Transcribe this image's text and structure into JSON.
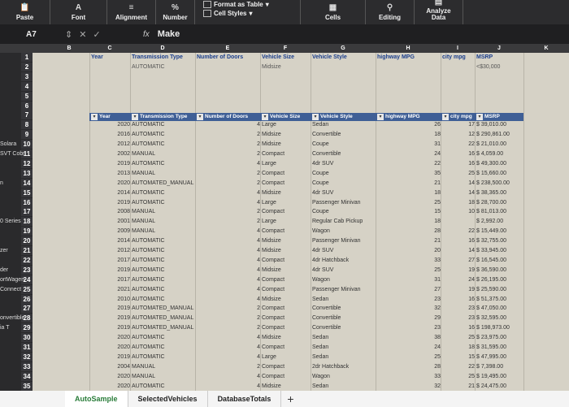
{
  "ribbon": {
    "paste": "Paste",
    "font": "Font",
    "alignment": "Alignment",
    "number": "Number",
    "format_as_table": "Format as Table",
    "cell_styles": "Cell Styles",
    "cells": "Cells",
    "editing": "Editing",
    "analyze_data": "Analyze Data"
  },
  "formula_bar": {
    "name_box": "A7",
    "fx": "fx",
    "value": "Make"
  },
  "columns": [
    "B",
    "C",
    "D",
    "E",
    "F",
    "G",
    "H",
    "I",
    "J",
    "K"
  ],
  "criteria": {
    "headers": [
      "Year",
      "Transmission Type",
      "Number of Doors",
      "Vehicle Size",
      "Vehicle Style",
      "highway MPG",
      "city mpg",
      "MSRP"
    ],
    "values": [
      "",
      "AUTOMATIC",
      "",
      "Midsize",
      "",
      "",
      "",
      "<$30,000"
    ]
  },
  "table_headers": [
    "Year",
    "Transmission Type",
    "Number of Doors",
    "Vehicle Size",
    "Vehicle Style",
    "highway MPG",
    "city mpg",
    "MSRP"
  ],
  "row_numbers": [
    "1",
    "2",
    "3",
    "4",
    "5",
    "6",
    "7",
    "8",
    "9",
    "10",
    "11",
    "12",
    "13",
    "14",
    "15",
    "16",
    "17",
    "18",
    "19",
    "20",
    "21",
    "22",
    "23",
    "24",
    "25",
    "26",
    "27",
    "28",
    "29",
    "30",
    "31",
    "32",
    "33",
    "34",
    "35"
  ],
  "row_labels": {
    "10": "Solara",
    "11": "SVT Cobra",
    "14": "n",
    "18": "0 Series",
    "21": "zer",
    "23": "der",
    "24": "ortWagen",
    "25": "Connect",
    "28": "onvertible",
    "29": "ia T"
  },
  "rows": [
    [
      "2020",
      "AUTOMATIC",
      "4",
      "Large",
      "Sedan",
      "26",
      "17",
      "$ 39,010.00"
    ],
    [
      "2016",
      "AUTOMATIC",
      "2",
      "Midsize",
      "Convertible",
      "18",
      "12",
      "$ 290,861.00"
    ],
    [
      "2012",
      "AUTOMATIC",
      "2",
      "Midsize",
      "Coupe",
      "31",
      "22",
      "$ 21,010.00"
    ],
    [
      "2002",
      "MANUAL",
      "2",
      "Compact",
      "Convertible",
      "24",
      "16",
      "$ 4,059.00"
    ],
    [
      "2019",
      "AUTOMATIC",
      "4",
      "Large",
      "4dr SUV",
      "22",
      "16",
      "$ 49,300.00"
    ],
    [
      "2013",
      "MANUAL",
      "2",
      "Compact",
      "Coupe",
      "35",
      "25",
      "$ 15,660.00"
    ],
    [
      "2020",
      "AUTOMATED_MANUAL",
      "2",
      "Compact",
      "Coupe",
      "21",
      "14",
      "$ 238,500.00"
    ],
    [
      "2014",
      "AUTOMATIC",
      "4",
      "Midsize",
      "4dr SUV",
      "18",
      "14",
      "$ 38,365.00"
    ],
    [
      "2019",
      "AUTOMATIC",
      "4",
      "Large",
      "Passenger Minivan",
      "25",
      "18",
      "$ 28,700.00"
    ],
    [
      "2008",
      "MANUAL",
      "2",
      "Compact",
      "Coupe",
      "15",
      "10",
      "$ 81,013.00"
    ],
    [
      "2001",
      "MANUAL",
      "2",
      "Large",
      "Regular Cab Pickup",
      "18",
      "",
      "$ 2,992.00"
    ],
    [
      "2009",
      "MANUAL",
      "4",
      "Compact",
      "Wagon",
      "28",
      "22",
      "$ 15,449.00"
    ],
    [
      "2014",
      "AUTOMATIC",
      "4",
      "Midsize",
      "Passenger Minivan",
      "21",
      "16",
      "$ 32,755.00"
    ],
    [
      "2012",
      "AUTOMATIC",
      "4",
      "Midsize",
      "4dr SUV",
      "20",
      "14",
      "$ 33,945.00"
    ],
    [
      "2017",
      "AUTOMATIC",
      "4",
      "Compact",
      "4dr Hatchback",
      "33",
      "27",
      "$ 16,545.00"
    ],
    [
      "2019",
      "AUTOMATIC",
      "4",
      "Midsize",
      "4dr SUV",
      "25",
      "19",
      "$ 36,590.00"
    ],
    [
      "2017",
      "AUTOMATIC",
      "4",
      "Compact",
      "Wagon",
      "31",
      "24",
      "$ 26,195.00"
    ],
    [
      "2021",
      "AUTOMATIC",
      "4",
      "Compact",
      "Passenger Minivan",
      "27",
      "19",
      "$ 25,590.00"
    ],
    [
      "2010",
      "AUTOMATIC",
      "4",
      "Midsize",
      "Sedan",
      "23",
      "16",
      "$ 51,375.00"
    ],
    [
      "2019",
      "AUTOMATED_MANUAL",
      "2",
      "Compact",
      "Convertible",
      "32",
      "23",
      "$ 47,050.00"
    ],
    [
      "2019",
      "AUTOMATED_MANUAL",
      "2",
      "Compact",
      "Convertible",
      "29",
      "23",
      "$ 32,595.00"
    ],
    [
      "2019",
      "AUTOMATED_MANUAL",
      "2",
      "Compact",
      "Convertible",
      "23",
      "16",
      "$ 198,973.00"
    ],
    [
      "2020",
      "AUTOMATIC",
      "4",
      "Midsize",
      "Sedan",
      "38",
      "25",
      "$ 23,975.00"
    ],
    [
      "2020",
      "AUTOMATIC",
      "4",
      "Compact",
      "Sedan",
      "24",
      "18",
      "$ 31,595.00"
    ],
    [
      "2019",
      "AUTOMATIC",
      "4",
      "Large",
      "Sedan",
      "25",
      "15",
      "$ 47,995.00"
    ],
    [
      "2004",
      "MANUAL",
      "2",
      "Compact",
      "2dr Hatchback",
      "28",
      "22",
      "$ 7,398.00"
    ],
    [
      "2020",
      "MANUAL",
      "4",
      "Compact",
      "Wagon",
      "33",
      "25",
      "$ 19,495.00"
    ],
    [
      "2020",
      "AUTOMATIC",
      "4",
      "Midsize",
      "Sedan",
      "32",
      "21",
      "$ 24,475.00"
    ]
  ],
  "tabs": [
    "AutoSample",
    "SelectedVehicles",
    "DatabaseTotals"
  ],
  "tab_add": "+"
}
